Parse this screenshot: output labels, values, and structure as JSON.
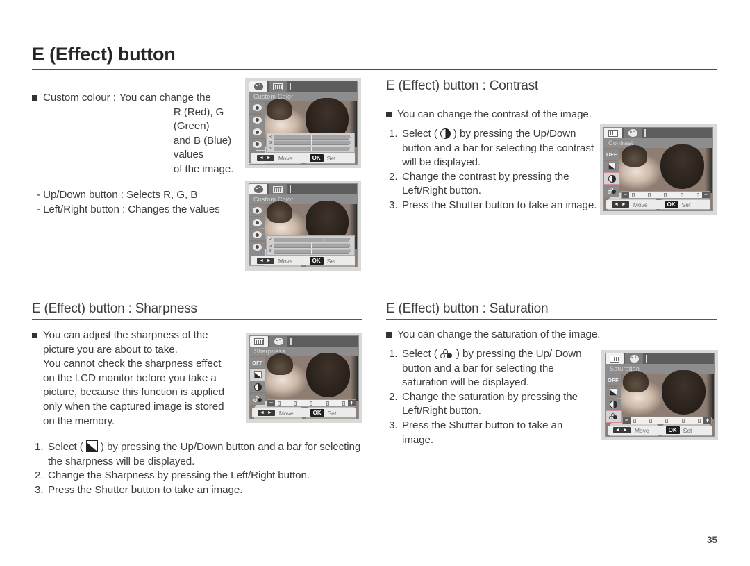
{
  "page": {
    "title": "E (Effect) button",
    "number": "35"
  },
  "custom_colour": {
    "bullet_label": "Custom colour :",
    "bullet_value_lines": [
      "You can change the",
      "R (Red), G (Green)",
      "and B (Blue) values",
      "of the image."
    ],
    "notes": [
      "- Up/Down button : Selects R, G, B",
      "- Left/Right button : Changes the values"
    ],
    "lcd": {
      "heading": "Custom Color",
      "tabs": [
        "palette-icon",
        "slider-icon"
      ],
      "active_tab": 0,
      "rgb_rows": [
        {
          "label": "R",
          "cap": "0"
        },
        {
          "label": "G",
          "cap": "0"
        },
        {
          "label": "B",
          "cap": "0"
        }
      ],
      "cmdbar": {
        "lr": "◄ ►",
        "move": "Move",
        "ok": "OK",
        "set": "Set"
      }
    }
  },
  "contrast": {
    "title": "E (Effect) button : Contrast",
    "bullet": "You can change the contrast of the image.",
    "steps": [
      {
        "n": "1.",
        "pre": "Select ( ",
        "icon": "contrast-icon",
        "post": " ) by pressing the Up/Down button and a bar for selecting the contrast will be displayed."
      },
      {
        "n": "2.",
        "pre": "Change the contrast by pressing the Left/Right button.",
        "icon": "",
        "post": ""
      },
      {
        "n": "3.",
        "pre": "Press the Shutter button to take an image.",
        "icon": "",
        "post": ""
      }
    ],
    "lcd": {
      "heading": "Contrast",
      "active_tab": 1,
      "strip": [
        "OFF",
        "sharpness-icon",
        "contrast-icon",
        "saturation-icon"
      ],
      "selected_strip_index": 2,
      "value_bar": {
        "minus": "−",
        "plus": "+",
        "ticks": [
          "0",
          "0",
          "0",
          "0",
          "0"
        ]
      },
      "cmdbar": {
        "lr": "◄ ►",
        "move": "Move",
        "ok": "OK",
        "set": "Set"
      }
    }
  },
  "sharpness": {
    "title": "E (Effect) button : Sharpness",
    "bullet_lines": [
      "You can adjust the sharpness of the",
      "picture you are about to take.",
      "You cannot check the sharpness effect",
      "on the LCD monitor before you take a",
      "picture, because this function is applied",
      "only when the captured image is stored",
      "on the memory."
    ],
    "steps": [
      {
        "n": "1.",
        "pre": "Select ( ",
        "icon": "sharpness-icon",
        "post": " ) by pressing the Up/Down button and a bar for selecting the sharpness will be displayed."
      },
      {
        "n": "2.",
        "pre": "Change the Sharpness by pressing the Left/Right button.",
        "icon": "",
        "post": ""
      },
      {
        "n": "3.",
        "pre": "Press the Shutter button to take an image.",
        "icon": "",
        "post": ""
      }
    ],
    "lcd": {
      "heading": "Sharpness",
      "active_tab": 1,
      "strip": [
        "OFF",
        "sharpness-icon",
        "contrast-icon",
        "saturation-icon"
      ],
      "selected_strip_index": 1,
      "value_bar": {
        "minus": "−",
        "plus": "+",
        "ticks": [
          "0",
          "0",
          "0",
          "0",
          "0"
        ]
      },
      "cmdbar": {
        "lr": "◄ ►",
        "move": "Move",
        "ok": "OK",
        "set": "Set"
      }
    }
  },
  "saturation": {
    "title": "E (Effect) button : Saturation",
    "bullet": "You can change the saturation of the image.",
    "steps": [
      {
        "n": "1.",
        "pre": "Select ( ",
        "icon": "saturation-icon",
        "post": " ) by pressing the Up/ Down button and a bar for selecting the saturation will be displayed."
      },
      {
        "n": "2.",
        "pre": "Change the saturation by pressing the Left/Right button.",
        "icon": "",
        "post": ""
      },
      {
        "n": "3.",
        "pre": "Press the Shutter button to take an image.",
        "icon": "",
        "post": ""
      }
    ],
    "lcd": {
      "heading": "Saturation",
      "active_tab": 1,
      "strip": [
        "OFF",
        "sharpness-icon",
        "contrast-icon",
        "saturation-icon"
      ],
      "selected_strip_index": 3,
      "value_bar": {
        "minus": "−",
        "plus": "+",
        "ticks": [
          "0",
          "0",
          "0",
          "0",
          "0"
        ]
      },
      "cmdbar": {
        "lr": "◄ ►",
        "move": "Move",
        "ok": "OK",
        "set": "Set"
      }
    }
  }
}
